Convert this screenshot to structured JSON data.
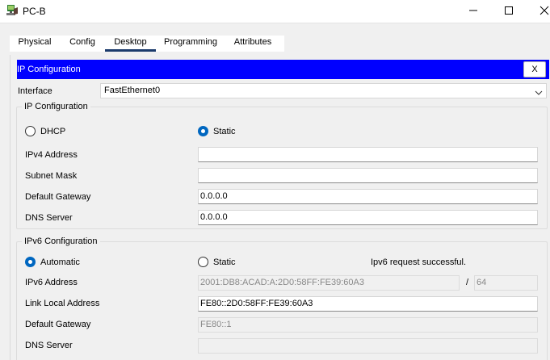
{
  "window": {
    "title": "PC-B",
    "icons": {
      "app": "pc-app-icon",
      "minimize": "minimize-icon",
      "maximize": "maximize-icon",
      "close": "close-icon"
    }
  },
  "tabs": [
    {
      "label": "Physical",
      "active": false
    },
    {
      "label": "Config",
      "active": false
    },
    {
      "label": "Desktop",
      "active": true
    },
    {
      "label": "Programming",
      "active": false
    },
    {
      "label": "Attributes",
      "active": false
    }
  ],
  "panel": {
    "title": "IP Configuration",
    "close_label": "X",
    "header_color": "#0000ff"
  },
  "interface": {
    "label": "Interface",
    "selected": "FastEthernet0"
  },
  "ipv4": {
    "group_title": "IP Configuration",
    "dhcp_label": "DHCP",
    "static_label": "Static",
    "mode": "static",
    "fields": {
      "ipv4_address": {
        "label": "IPv4 Address",
        "value": ""
      },
      "subnet_mask": {
        "label": "Subnet Mask",
        "value": ""
      },
      "default_gateway": {
        "label": "Default Gateway",
        "value": "0.0.0.0"
      },
      "dns_server": {
        "label": "DNS Server",
        "value": "0.0.0.0"
      }
    }
  },
  "ipv6": {
    "group_title": "IPv6 Configuration",
    "automatic_label": "Automatic",
    "static_label": "Static",
    "mode": "automatic",
    "status": "Ipv6 request successful.",
    "fields": {
      "ipv6_address": {
        "label": "IPv6 Address",
        "value": "2001:DB8:ACAD:A:2D0:58FF:FE39:60A3",
        "prefix_sep": "/",
        "prefix": "64"
      },
      "link_local": {
        "label": "Link Local Address",
        "value": "FE80::2D0:58FF:FE39:60A3"
      },
      "default_gateway": {
        "label": "Default Gateway",
        "value": "FE80::1"
      },
      "dns_server": {
        "label": "DNS Server",
        "value": ""
      }
    }
  }
}
